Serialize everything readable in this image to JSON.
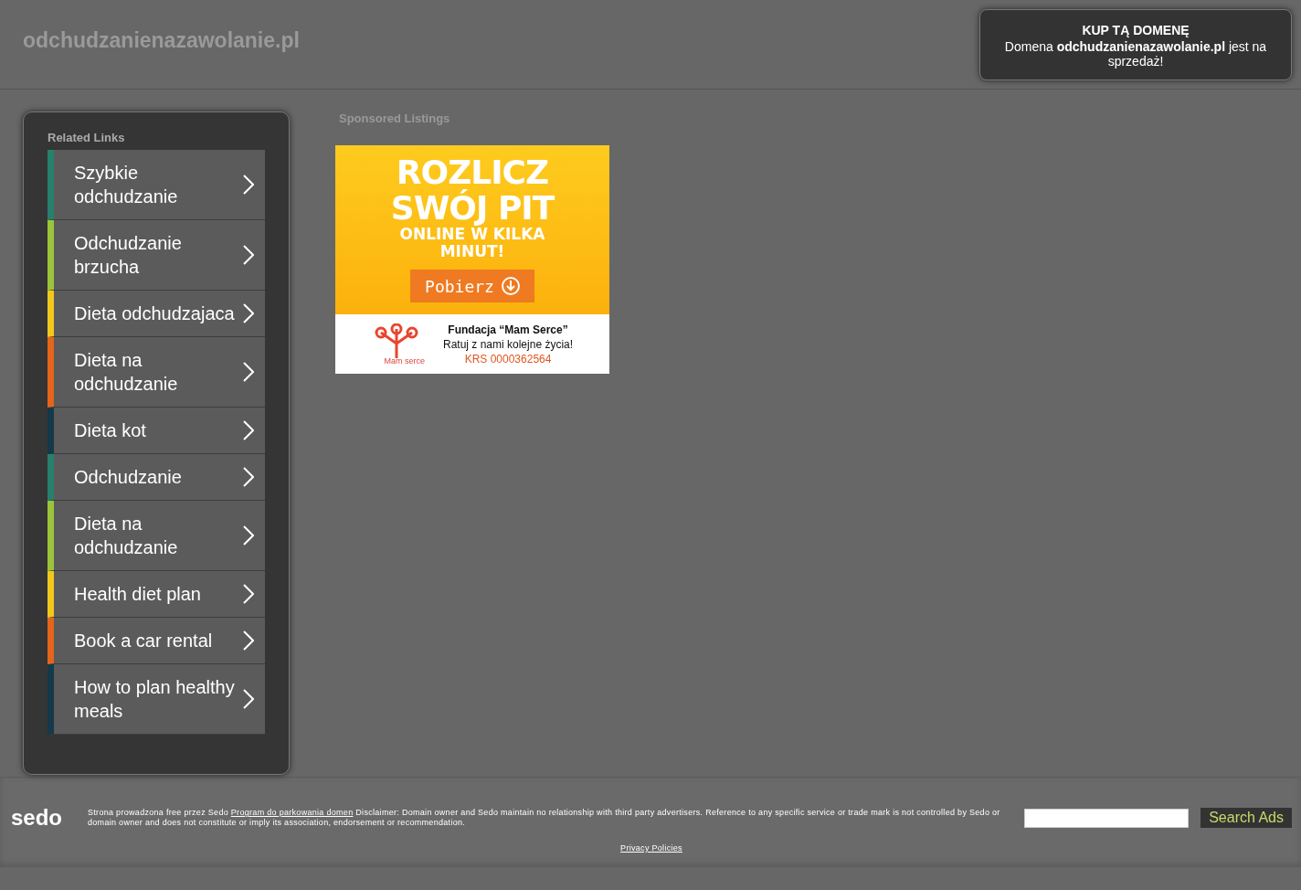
{
  "header": {
    "site_title": "odchudzanienazawolanie.pl"
  },
  "buy_box": {
    "title": "KUP TĄ DOMENĘ",
    "message": "Domena **odchudzanienazawolanie.pl** jest na sprzedaż!"
  },
  "related_links": {
    "title": "Related Links",
    "items": [
      {
        "label": "Szybkie odchudzanie",
        "color": "#26806c"
      },
      {
        "label": "Odchudzanie brzucha",
        "color": "#9cc43a"
      },
      {
        "label": "Dieta odchudzajaca",
        "color": "#f2c81c"
      },
      {
        "label": "Dieta na odchudzanie",
        "color": "#e5651b"
      },
      {
        "label": "Dieta kot",
        "color": "#14394a"
      },
      {
        "label": "Odchudzanie",
        "color": "#26806c"
      },
      {
        "label": "Dieta na odchudzanie",
        "color": "#9cc43a"
      },
      {
        "label": "Health diet plan",
        "color": "#f2c81c"
      },
      {
        "label": "Book a car rental",
        "color": "#e5651b"
      },
      {
        "label": "How to plan healthy meals",
        "color": "#14394a"
      }
    ]
  },
  "sponsored": {
    "title": "Sponsored Listings",
    "ad": {
      "headline": "ROZLICZ SWÓJ PIT",
      "subline": "ONLINE W KILKA MINUT!",
      "button": "Pobierz",
      "org": "Fundacja “Mam Serce”",
      "slogan": "Ratuj z nami kolejne życia!",
      "krs": "KRS 0000362564",
      "logo_text": "Mam serce"
    }
  },
  "footer": {
    "logo": "sedo",
    "disclaimer_before": "Strona prowadzona free przez Sedo",
    "disclaimer_link": "Program do parkowania domen",
    "disclaimer_after": "Disclaimer: Domain owner and Sedo maintain no relationship with third party advertisers. Reference to any specific service or trade mark is not controlled by Sedo or domain owner and does not constitute or imply its association, endorsement or recommendation.",
    "search_button": "Search Ads",
    "privacy_link": "Privacy Policies"
  }
}
